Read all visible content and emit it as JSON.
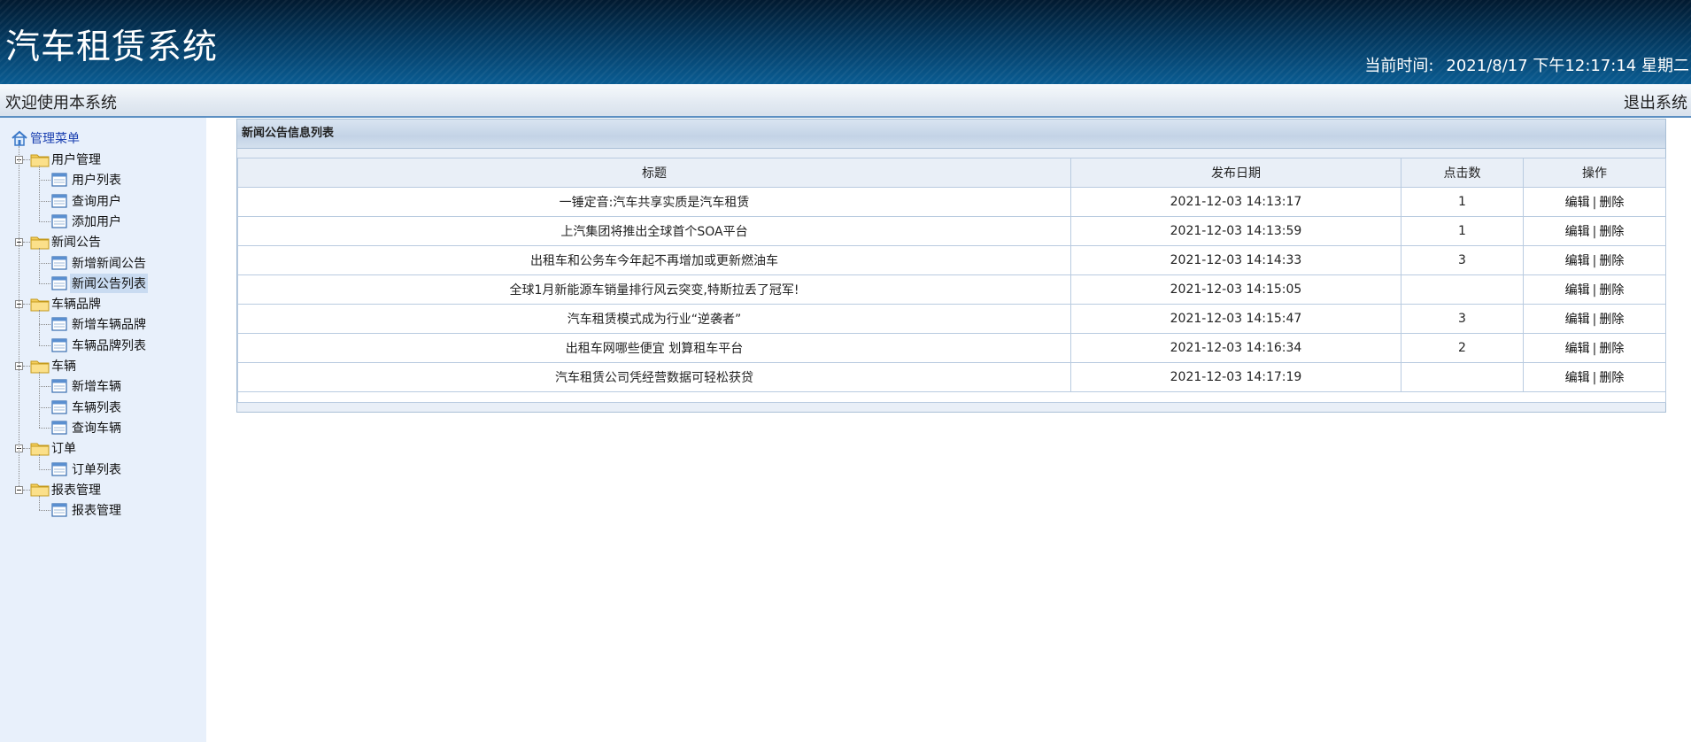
{
  "header": {
    "app_title": "汽车租赁系统",
    "time_label": "当前时间:",
    "time_value": "2021/8/17 下午12:17:14 星期二"
  },
  "topbar": {
    "welcome": "欢迎使用本系统",
    "logout": "退出系统"
  },
  "sidebar": {
    "root_label": "管理菜单",
    "groups": [
      {
        "label": "用户管理",
        "items": [
          "用户列表",
          "查询用户",
          "添加用户"
        ]
      },
      {
        "label": "新闻公告",
        "items": [
          "新增新闻公告",
          "新闻公告列表"
        ]
      },
      {
        "label": "车辆品牌",
        "items": [
          "新增车辆品牌",
          "车辆品牌列表"
        ]
      },
      {
        "label": "车辆",
        "items": [
          "新增车辆",
          "车辆列表",
          "查询车辆"
        ]
      },
      {
        "label": "订单",
        "items": [
          "订单列表"
        ]
      },
      {
        "label": "报表管理",
        "items": [
          "报表管理"
        ]
      }
    ],
    "active_item": "新闻公告列表"
  },
  "panel": {
    "title": "新闻公告信息列表",
    "columns": [
      "标题",
      "发布日期",
      "点击数",
      "操作"
    ],
    "edit_label": "编辑",
    "delete_label": "删除",
    "separator": "|",
    "rows": [
      {
        "title": "一锤定音:汽车共享实质是汽车租赁",
        "date": "2021-12-03 14:13:17",
        "clicks": "1"
      },
      {
        "title": "上汽集团将推出全球首个SOA平台",
        "date": "2021-12-03 14:13:59",
        "clicks": "1"
      },
      {
        "title": "出租车和公务车今年起不再增加或更新燃油车",
        "date": "2021-12-03 14:14:33",
        "clicks": "3"
      },
      {
        "title": "全球1月新能源车销量排行风云突变,特斯拉丢了冠军!",
        "date": "2021-12-03 14:15:05",
        "clicks": ""
      },
      {
        "title": "汽车租赁模式成为行业“逆袭者”",
        "date": "2021-12-03 14:15:47",
        "clicks": "3"
      },
      {
        "title": "出租车网哪些便宜 划算租车平台",
        "date": "2021-12-03 14:16:34",
        "clicks": "2"
      },
      {
        "title": "汽车租赁公司凭经营数据可轻松获贷",
        "date": "2021-12-03 14:17:19",
        "clicks": ""
      }
    ]
  },
  "colors": {
    "header_dark": "#021a30",
    "header_light": "#0a5c92",
    "sidebar_bg": "#e8f0fb",
    "root_link": "#1a3fb0",
    "table_border": "#b9cbe0"
  }
}
